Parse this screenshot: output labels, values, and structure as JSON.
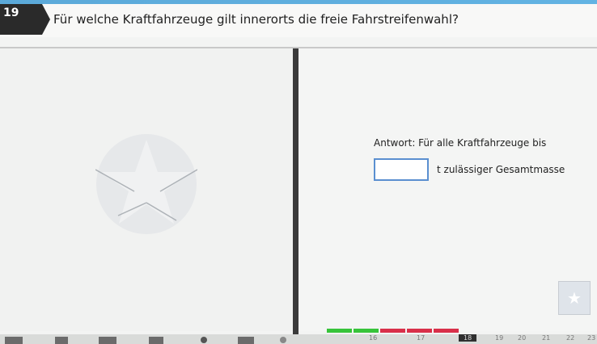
{
  "question": {
    "number": "19",
    "text": "Für welche Kraftfahrzeuge gilt innerorts die freie Fahrstreifenwahl?"
  },
  "answer": {
    "line1": "Antwort: Für alle Kraftfahrzeuge bis",
    "input_value": "",
    "line2": "t zulässiger Gesamtmasse"
  },
  "progress_colors": [
    "#37c43a",
    "#37c43a",
    "#d9304a",
    "#d9304a",
    "#d9304a"
  ],
  "nav_numbers": {
    "n16": "16",
    "n17": "17",
    "n18": "18",
    "n19": "19",
    "n20": "20",
    "n21": "21",
    "n22": "22",
    "n23": "23"
  },
  "icons": {
    "favorite": "star-icon",
    "sign": "sign-icon"
  }
}
